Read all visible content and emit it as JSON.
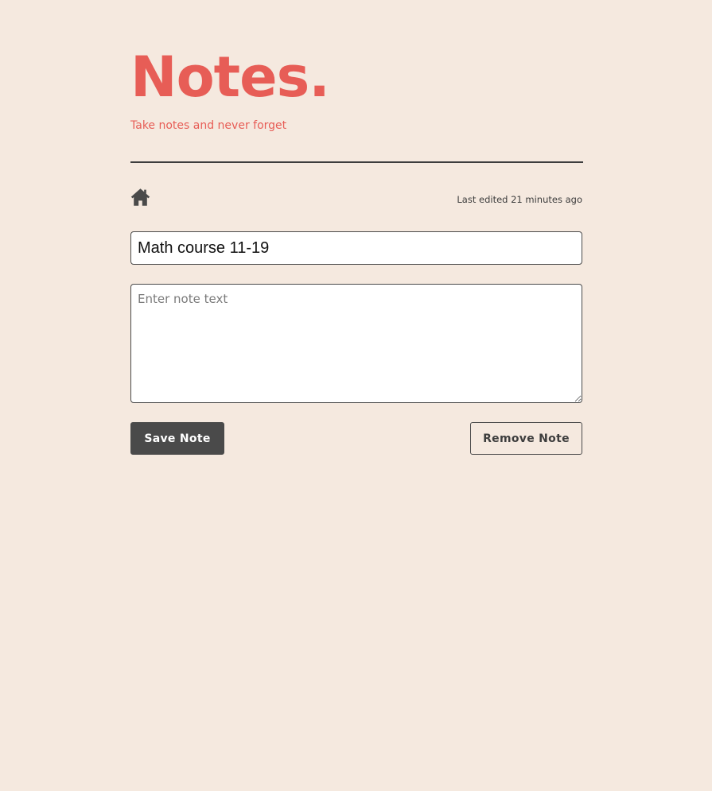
{
  "header": {
    "title": "Notes.",
    "subtitle": "Take notes and never forget"
  },
  "toolbar": {
    "home_icon": "home-icon",
    "last_edited": "Last edited 21 minutes ago"
  },
  "note": {
    "title_value": "Math course 11-19",
    "body_value": "",
    "body_placeholder": "Enter note text"
  },
  "actions": {
    "save_label": "Save Note",
    "remove_label": "Remove Note"
  },
  "colors": {
    "background": "#f5e9df",
    "accent": "#e75d56",
    "dark": "#4a4a4a"
  }
}
